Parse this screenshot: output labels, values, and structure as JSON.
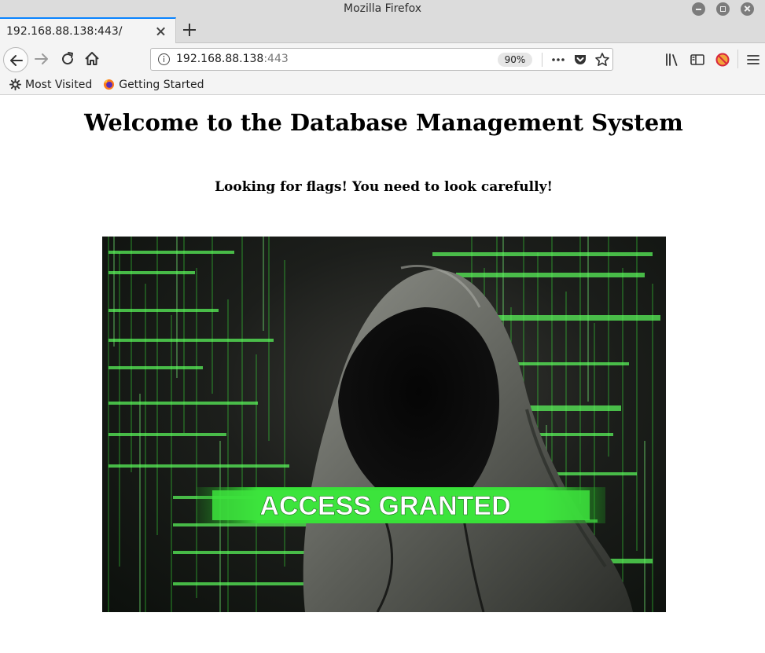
{
  "window": {
    "title": "Mozilla Firefox"
  },
  "tab": {
    "title": "192.168.88.138:443/"
  },
  "urlbar": {
    "host": "192.168.88.138",
    "port": ":443",
    "zoom": "90%"
  },
  "bookmarks": [
    {
      "label": "Most Visited",
      "icon": "gear-icon"
    },
    {
      "label": "Getting Started",
      "icon": "firefox-icon"
    }
  ],
  "page": {
    "title": "Welcome to the Database Management System",
    "subtitle": "Looking for flags! You need to look carefully!",
    "image_text": "ACCESS GRANTED"
  },
  "colors": {
    "accent": "#0a84ff",
    "matrix_green": "#3cf03c",
    "banner_green": "#38e038"
  }
}
